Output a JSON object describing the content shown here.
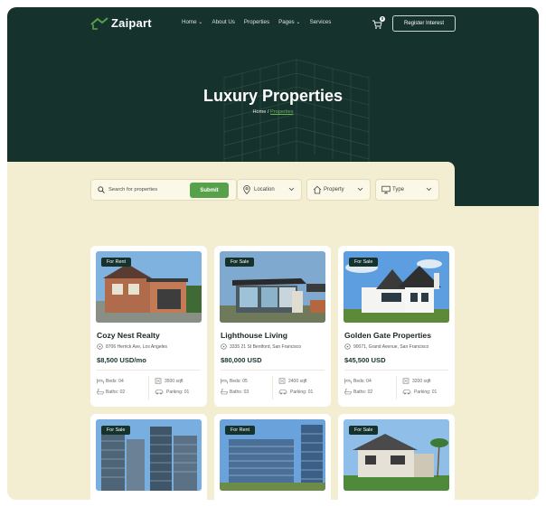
{
  "nav": {
    "logo": "Zaipart",
    "menu": [
      "Home",
      "About Us",
      "Properties",
      "Pages",
      "Services"
    ],
    "cart_count": "0",
    "register": "Register Interest"
  },
  "hero": {
    "title": "Luxury Properties",
    "breadcrumb_home": "Home",
    "breadcrumb_sep": " / ",
    "breadcrumb_current": "Properties"
  },
  "search": {
    "placeholder": "Search for properties",
    "submit": "Submit",
    "location": "Location",
    "property": "Property",
    "type": "Type"
  },
  "cards": [
    {
      "badge": "For Rent",
      "name": "Cozy Nest Realty",
      "address": "8706 Herrick Ave, Los Angeles",
      "price": "$8,500 USD/mo",
      "beds": "Beds: 04",
      "sqft": "3500 sqft",
      "baths": "Baths: 02",
      "parking": "Parking: 01"
    },
    {
      "badge": "For Sale",
      "name": "Lighthouse Living",
      "address": "3335 21 St Bentford, San Francisco",
      "price": "$80,000 USD",
      "beds": "Beds: 05",
      "sqft": "2400 sqft",
      "baths": "Baths: 03",
      "parking": "Parking: 01"
    },
    {
      "badge": "For Sale",
      "name": "Golden Gate Properties",
      "address": "90071, Grand Avenue, San Francisco",
      "price": "$45,500 USD",
      "beds": "Beds: 04",
      "sqft": "3200 sqft",
      "baths": "Baths: 02",
      "parking": "Parking: 01"
    },
    {
      "badge": "For Sale"
    },
    {
      "badge": "For Rent"
    },
    {
      "badge": "For Sale"
    }
  ],
  "colors": {
    "dark_green": "#16322d",
    "accent_green": "#57a14a",
    "cream": "#f3eed1"
  }
}
